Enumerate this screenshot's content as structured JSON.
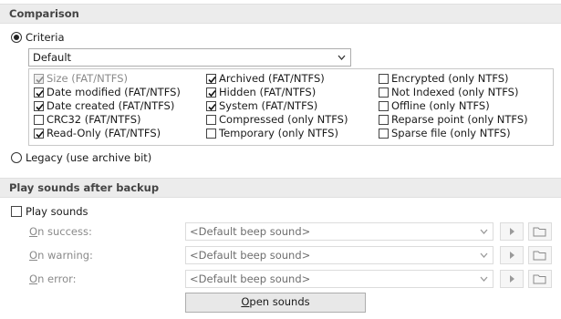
{
  "comparison": {
    "header": "Comparison",
    "criteria_label": "Criteria",
    "criteria_selected": true,
    "dropdown_value": "Default",
    "checkboxes": [
      {
        "label": "Size (FAT/NTFS)",
        "checked": true,
        "disabled": true
      },
      {
        "label": "Date modified (FAT/NTFS)",
        "checked": true,
        "disabled": false
      },
      {
        "label": "Date created (FAT/NTFS)",
        "checked": true,
        "disabled": false
      },
      {
        "label": "CRC32 (FAT/NTFS)",
        "checked": false,
        "disabled": false
      },
      {
        "label": "Read-Only (FAT/NTFS)",
        "checked": true,
        "disabled": false
      },
      {
        "label": "Archived (FAT/NTFS)",
        "checked": true,
        "disabled": false
      },
      {
        "label": "Hidden (FAT/NTFS)",
        "checked": true,
        "disabled": false
      },
      {
        "label": "System (FAT/NTFS)",
        "checked": true,
        "disabled": false
      },
      {
        "label": "Compressed (only NTFS)",
        "checked": false,
        "disabled": false
      },
      {
        "label": "Temporary (only NTFS)",
        "checked": false,
        "disabled": false
      },
      {
        "label": "Encrypted (only NTFS)",
        "checked": false,
        "disabled": false
      },
      {
        "label": "Not Indexed (only NTFS)",
        "checked": false,
        "disabled": false
      },
      {
        "label": "Offline (only NTFS)",
        "checked": false,
        "disabled": false
      },
      {
        "label": "Reparse point (only NTFS)",
        "checked": false,
        "disabled": false
      },
      {
        "label": "Sparse file (only NTFS)",
        "checked": false,
        "disabled": false
      }
    ],
    "legacy_label": "Legacy (use archive bit)",
    "legacy_selected": false
  },
  "sounds": {
    "header": "Play sounds after backup",
    "play_label": "Play sounds",
    "play_checked": false,
    "rows": [
      {
        "label": "On success:",
        "value": "<Default beep sound>"
      },
      {
        "label": "On warning:",
        "value": "<Default beep sound>"
      },
      {
        "label": "On error:",
        "value": "<Default beep sound>"
      }
    ],
    "open_button": "Open sounds"
  },
  "icons": {
    "play": "play-icon",
    "folder": "folder-icon",
    "dropdown": "chevron-down-icon"
  }
}
